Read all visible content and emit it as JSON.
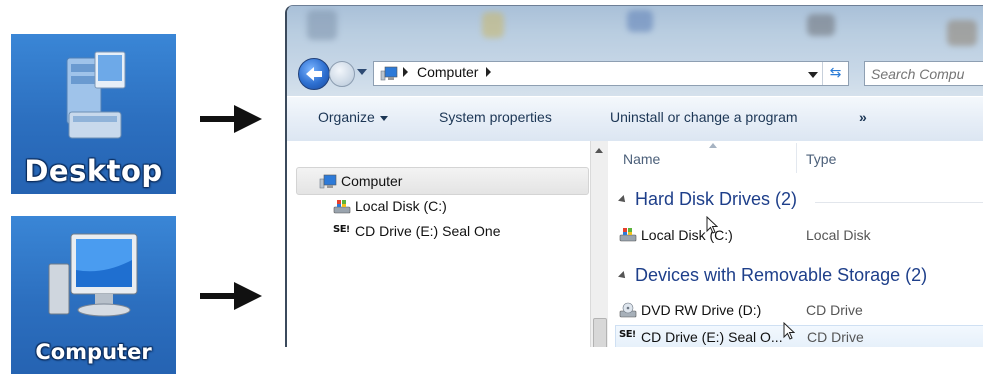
{
  "desktop_icons": [
    {
      "label": "Desktop"
    },
    {
      "label": "Computer"
    }
  ],
  "explorer": {
    "address": {
      "crumb": "Computer",
      "search_placeholder": "Search Compu"
    },
    "toolbar": {
      "organize": "Organize",
      "system_properties": "System properties",
      "uninstall": "Uninstall or change a program",
      "overflow": "»"
    },
    "nav_pane": {
      "items": [
        {
          "label": "Computer",
          "icon": "computer-icon",
          "selected": true
        },
        {
          "label": "Local Disk (C:)",
          "icon": "local-disk-icon"
        },
        {
          "label": "CD Drive (E:) Seal One",
          "icon": "seal-one-icon"
        }
      ]
    },
    "columns": {
      "name": "Name",
      "type": "Type"
    },
    "groups": [
      {
        "title": "Hard Disk Drives (2)",
        "items": [
          {
            "name": "Local Disk (C:)",
            "type": "Local Disk",
            "icon": "local-disk-icon"
          }
        ]
      },
      {
        "title": "Devices with Removable Storage (2)",
        "items": [
          {
            "name": "DVD RW Drive (D:)",
            "type": "CD Drive",
            "icon": "dvd-drive-icon"
          },
          {
            "name": "CD Drive (E:) Seal O...",
            "type": "CD Drive",
            "icon": "seal-one-icon",
            "selected": true
          }
        ]
      }
    ]
  },
  "seal_one_badge": "SE",
  "colors": {
    "desktop_bg": "#2e75c4",
    "group_header": "#1e3f8a",
    "toolbar_text": "#1c3655"
  }
}
